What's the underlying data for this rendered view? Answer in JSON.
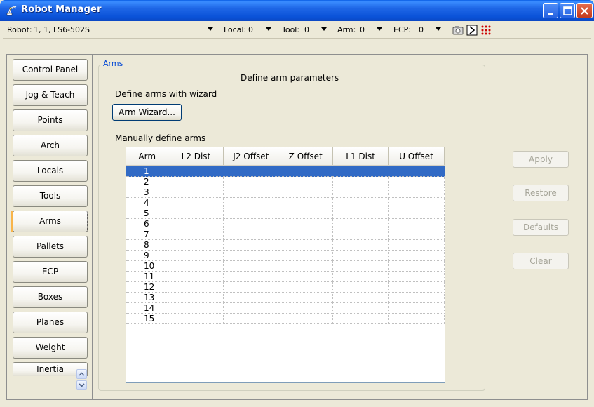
{
  "window": {
    "title": "Robot Manager"
  },
  "toolbar": {
    "robot_label": "Robot:",
    "robot_value": "1, 1, LS6-502S",
    "local_label": "Local:",
    "local_value": "0",
    "tool_label": "Tool:",
    "tool_value": "0",
    "arm_label": "Arm:",
    "arm_value": "0",
    "ecp_label": "ECP:",
    "ecp_value": "0"
  },
  "nav": {
    "items": [
      {
        "label": "Control Panel"
      },
      {
        "label": "Jog & Teach"
      },
      {
        "label": "Points"
      },
      {
        "label": "Arch"
      },
      {
        "label": "Locals"
      },
      {
        "label": "Tools"
      },
      {
        "label": "Arms"
      },
      {
        "label": "Pallets"
      },
      {
        "label": "ECP"
      },
      {
        "label": "Boxes"
      },
      {
        "label": "Planes"
      },
      {
        "label": "Weight"
      },
      {
        "label": "Inertia"
      }
    ],
    "active": "Arms"
  },
  "main": {
    "group_title": "Arms",
    "heading": "Define arm parameters",
    "wizard_label": "Define arms with wizard",
    "wizard_button": "Arm Wizard...",
    "manual_label": "Manually define arms",
    "table": {
      "columns": [
        "Arm",
        "L2 Dist",
        "J2 Offset",
        "Z Offset",
        "L1 Dist",
        "U Offset"
      ],
      "rows": [
        [
          "1",
          "",
          "",
          "",
          "",
          ""
        ],
        [
          "2",
          "",
          "",
          "",
          "",
          ""
        ],
        [
          "3",
          "",
          "",
          "",
          "",
          ""
        ],
        [
          "4",
          "",
          "",
          "",
          "",
          ""
        ],
        [
          "5",
          "",
          "",
          "",
          "",
          ""
        ],
        [
          "6",
          "",
          "",
          "",
          "",
          ""
        ],
        [
          "7",
          "",
          "",
          "",
          "",
          ""
        ],
        [
          "8",
          "",
          "",
          "",
          "",
          ""
        ],
        [
          "9",
          "",
          "",
          "",
          "",
          ""
        ],
        [
          "10",
          "",
          "",
          "",
          "",
          ""
        ],
        [
          "11",
          "",
          "",
          "",
          "",
          ""
        ],
        [
          "12",
          "",
          "",
          "",
          "",
          ""
        ],
        [
          "13",
          "",
          "",
          "",
          "",
          ""
        ],
        [
          "14",
          "",
          "",
          "",
          "",
          ""
        ],
        [
          "15",
          "",
          "",
          "",
          "",
          ""
        ]
      ],
      "selected_row": "1"
    }
  },
  "actions": {
    "apply": "Apply",
    "restore": "Restore",
    "defaults": "Defaults",
    "clear": "Clear"
  },
  "colors": {
    "titlebar": "#0A52D8",
    "selection": "#316AC5",
    "group_title": "#0046D5",
    "disabled_text": "#A7A69A",
    "active_tab_accent": "#F8B44A"
  },
  "icons": {
    "title": "robot-arm-icon",
    "toolbar": [
      "camera-icon",
      "run-icon",
      "io-dots-icon"
    ]
  }
}
